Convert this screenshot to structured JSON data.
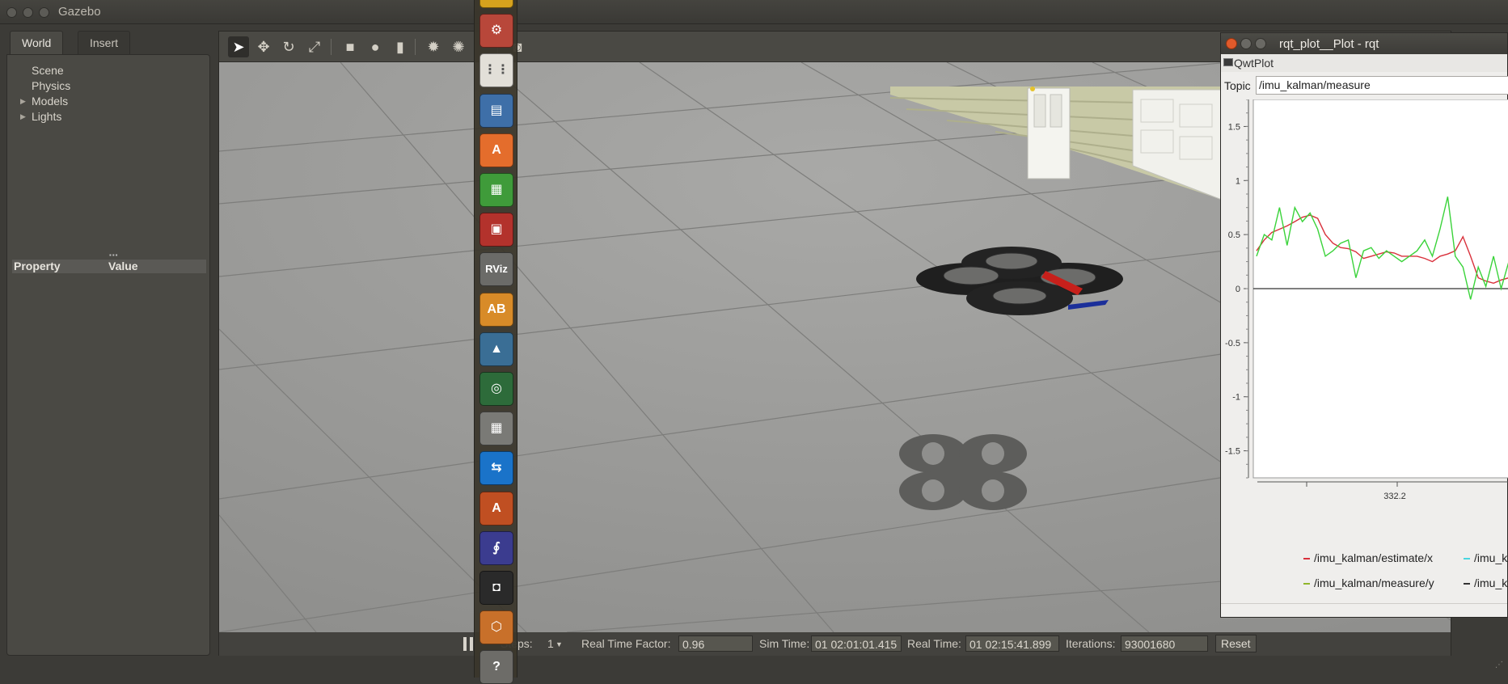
{
  "window": {
    "title": "Gazebo"
  },
  "left_panel": {
    "tabs": [
      {
        "label": "World"
      },
      {
        "label": "Insert"
      }
    ],
    "tree": [
      {
        "label": "Scene",
        "expandable": false
      },
      {
        "label": "Physics",
        "expandable": false
      },
      {
        "label": "Models",
        "expandable": true
      },
      {
        "label": "Lights",
        "expandable": true
      }
    ],
    "property_header": {
      "property": "Property",
      "value": "Value"
    }
  },
  "toolbar": {
    "tools": [
      {
        "name": "select-tool",
        "icon": "arrow-cursor-icon",
        "glyph": "➤"
      },
      {
        "name": "translate-tool",
        "icon": "move-arrows-icon",
        "glyph": "✥"
      },
      {
        "name": "rotate-tool",
        "icon": "rotate-icon",
        "glyph": "↻"
      },
      {
        "name": "scale-tool",
        "icon": "scale-icon",
        "glyph": "⤢"
      },
      {
        "name": "box-shape",
        "icon": "box-icon",
        "glyph": "■"
      },
      {
        "name": "sphere-shape",
        "icon": "sphere-icon",
        "glyph": "●"
      },
      {
        "name": "cylinder-shape",
        "icon": "cylinder-icon",
        "glyph": "▮"
      },
      {
        "name": "point-light",
        "icon": "sun-icon",
        "glyph": "✹"
      },
      {
        "name": "spot-light",
        "icon": "spotlight-icon",
        "glyph": "✺"
      },
      {
        "name": "screenshot",
        "icon": "camera-icon",
        "glyph": "◙"
      }
    ]
  },
  "statusbar": {
    "steps_label": "Steps:",
    "steps_value": "1",
    "real_time_factor_label": "Real Time Factor:",
    "real_time_factor": "0.96",
    "sim_time_label": "Sim Time:",
    "sim_time": "01 02:01:01.415",
    "real_time_label": "Real Time:",
    "real_time": "01 02:15:41.899",
    "iterations_label": "Iterations:",
    "iterations": "93001680",
    "reset_label": "Reset"
  },
  "launcher": {
    "items": [
      {
        "name": "chrome-icon",
        "color": "#d6a21d",
        "glyph": "◉"
      },
      {
        "name": "system-settings-icon",
        "color": "#b8473a",
        "glyph": "⚙"
      },
      {
        "name": "apps-grid-icon",
        "color": "#e2dfd8",
        "glyph": "⋮⋮"
      },
      {
        "name": "document-viewer-icon",
        "color": "#3e6fa8",
        "glyph": "▤"
      },
      {
        "name": "software-center-icon",
        "color": "#e46d2c",
        "glyph": "A"
      },
      {
        "name": "spreadsheet-icon",
        "color": "#3f9b3a",
        "glyph": "▦"
      },
      {
        "name": "terminal-red-icon",
        "color": "#b3322c",
        "glyph": "▣"
      },
      {
        "name": "rviz-icon",
        "color": "#6b6b68",
        "glyph": "RViz"
      },
      {
        "name": "dictionary-icon",
        "color": "#d88b28",
        "glyph": "AB"
      },
      {
        "name": "matlab-icon",
        "color": "#3a6e95",
        "glyph": "▲"
      },
      {
        "name": "webcam-icon",
        "color": "#2d6b3a",
        "glyph": "◎"
      },
      {
        "name": "calculator-icon",
        "color": "#7a7a76",
        "glyph": "▦"
      },
      {
        "name": "teamviewer-icon",
        "color": "#1a73c9",
        "glyph": "⇆"
      },
      {
        "name": "software-updater-icon",
        "color": "#c04f22",
        "glyph": "A"
      },
      {
        "name": "mathematica-icon",
        "color": "#3b3c8f",
        "glyph": "∮"
      },
      {
        "name": "screenshot-tool-icon",
        "color": "#2a2a2a",
        "glyph": "◘"
      },
      {
        "name": "package-icon",
        "color": "#c8702a",
        "glyph": "⬡"
      },
      {
        "name": "help-icon",
        "color": "#6d6c68",
        "glyph": "?"
      }
    ]
  },
  "rqt": {
    "title": "rqt_plot__Plot - rqt",
    "subtitle": "QwtPlot",
    "topic_label": "Topic",
    "topic_value": "/imu_kalman/measure",
    "legend": [
      {
        "label": "/imu_kalman/estimate/x",
        "color": "#d9303b"
      },
      {
        "label": "/imu_k",
        "color": "#49d6e0"
      },
      {
        "label": "/imu_kalman/measure/y",
        "color": "#8fb52a"
      },
      {
        "label": "/imu_k",
        "color": "#333333"
      }
    ]
  },
  "chart_data": {
    "type": "line",
    "title": "",
    "xlabel": "",
    "ylabel": "",
    "x_tick_labels": [
      "332.2"
    ],
    "y_ticks": [
      1.5,
      1,
      0.5,
      0,
      -0.5,
      -1,
      -1.5
    ],
    "ylim": [
      -1.75,
      1.75
    ],
    "series": [
      {
        "name": "/imu_kalman/estimate/x",
        "color": "#d9303b",
        "values": [
          0.35,
          0.45,
          0.52,
          0.55,
          0.58,
          0.62,
          0.66,
          0.68,
          0.65,
          0.5,
          0.42,
          0.38,
          0.37,
          0.34,
          0.28,
          0.3,
          0.32,
          0.34,
          0.33,
          0.3,
          0.3,
          0.3,
          0.28,
          0.25,
          0.3,
          0.32,
          0.35,
          0.48,
          0.3,
          0.1,
          0.07,
          0.05,
          0.08,
          0.1
        ]
      },
      {
        "name": "/imu_kalman/measure/y",
        "color": "#3ad33a",
        "values": [
          0.3,
          0.5,
          0.45,
          0.75,
          0.4,
          0.75,
          0.62,
          0.7,
          0.55,
          0.3,
          0.35,
          0.42,
          0.45,
          0.1,
          0.35,
          0.38,
          0.28,
          0.35,
          0.3,
          0.25,
          0.3,
          0.35,
          0.45,
          0.3,
          0.55,
          0.85,
          0.3,
          0.2,
          -0.1,
          0.2,
          0.02,
          0.3,
          0.0,
          0.25
        ]
      },
      {
        "name": "/imu_kalman/measure/y",
        "color": "#333333",
        "values": [
          0,
          0
        ]
      }
    ]
  }
}
